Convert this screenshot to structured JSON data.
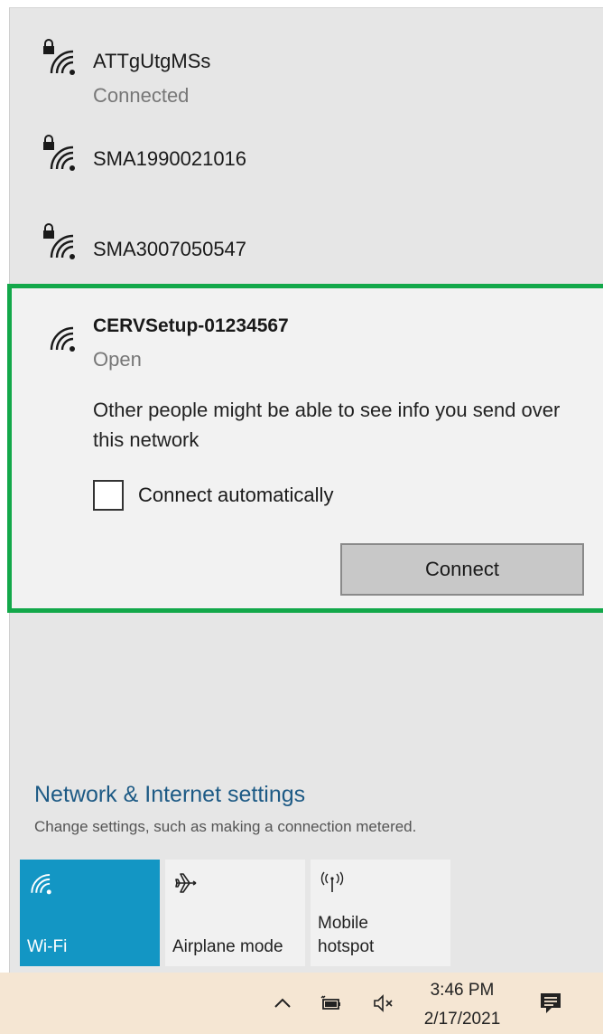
{
  "networks": [
    {
      "name": "ATTgUtgMSs",
      "status": "Connected",
      "secured": true
    },
    {
      "name": "SMA1990021016",
      "status": "",
      "secured": true
    },
    {
      "name": "SMA3007050547",
      "status": "",
      "secured": true
    }
  ],
  "selected_network": {
    "name": "CERVSetup-01234567",
    "status": "Open",
    "warning": "Other people might be able to see info you send over this network",
    "connect_auto_label": "Connect automatically",
    "connect_auto_checked": false,
    "connect_label": "Connect"
  },
  "settings": {
    "link": "Network & Internet settings",
    "description": "Change settings, such as making a connection metered."
  },
  "quick_actions": [
    {
      "label": "Wi-Fi",
      "icon": "wifi-icon",
      "active": true
    },
    {
      "label": "Airplane mode",
      "icon": "airplane-icon",
      "active": false
    },
    {
      "label": "Mobile\nhotspot",
      "icon": "hotspot-icon",
      "active": false
    }
  ],
  "taskbar": {
    "time": "3:46 PM",
    "date": "2/17/2021",
    "icons": [
      "chevron-up-icon",
      "battery-icon",
      "volume-muted-icon",
      "notifications-icon"
    ]
  },
  "colors": {
    "highlight_border": "#13a84a",
    "active_tile": "#1396c4",
    "link": "#1d5a85"
  }
}
